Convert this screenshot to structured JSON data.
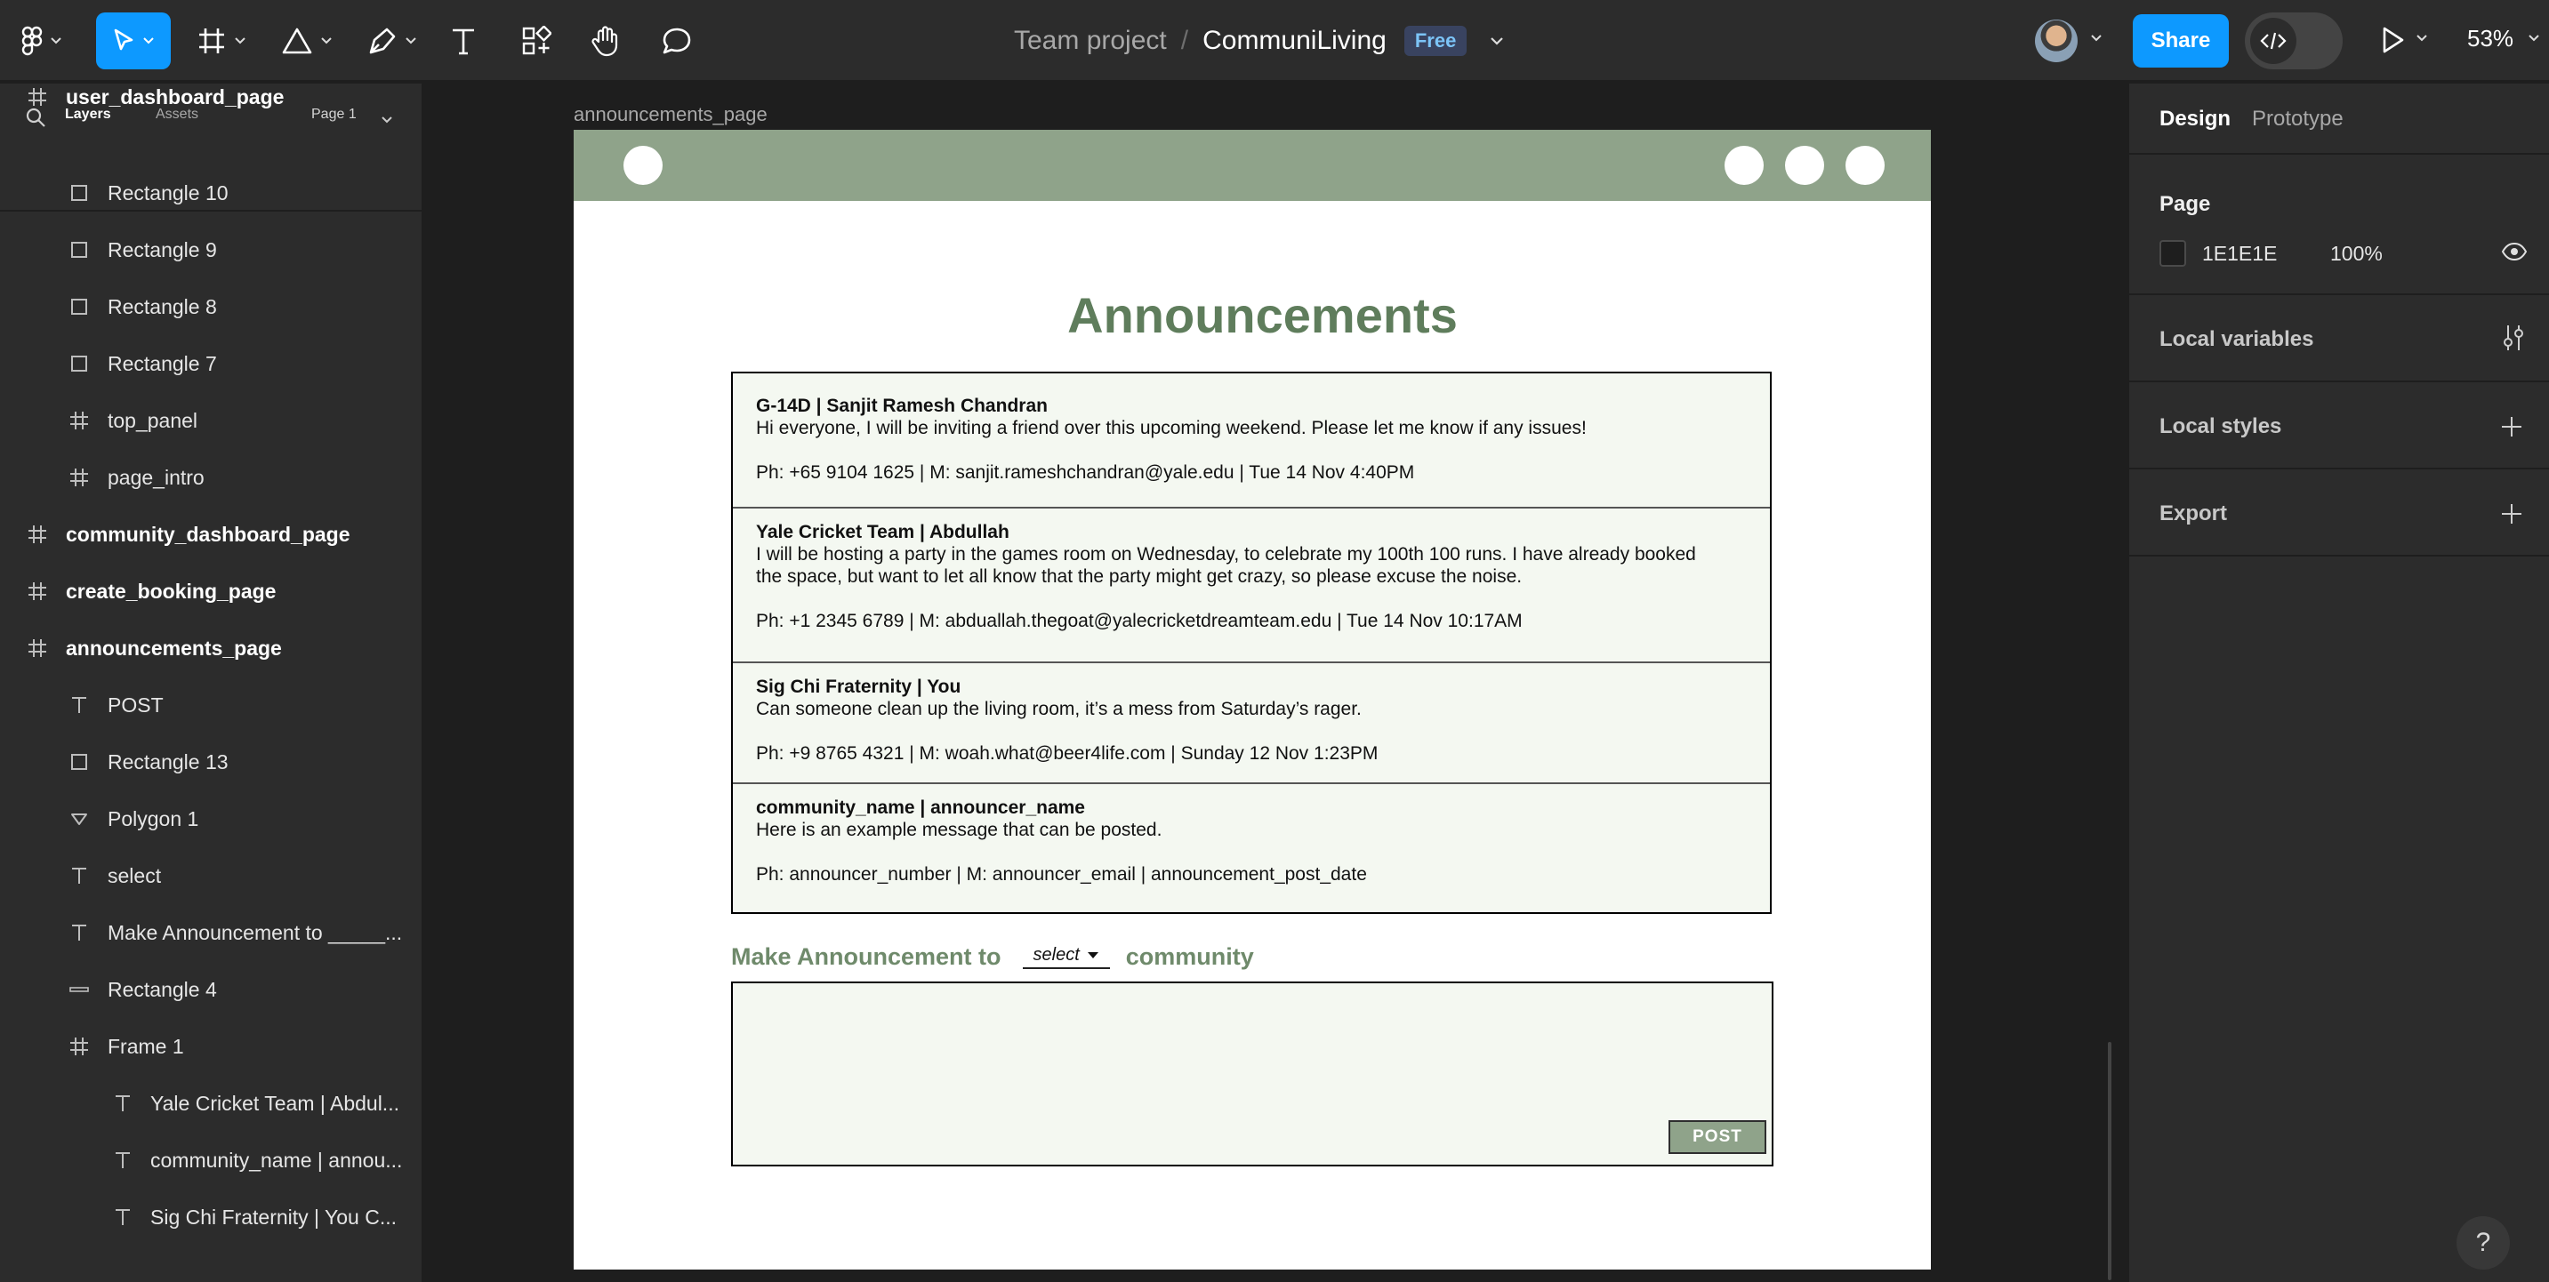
{
  "toolbar": {
    "breadcrumb_team": "Team project",
    "breadcrumb_sep": "/",
    "file_name": "CommuniLiving",
    "plan_badge": "Free",
    "share_label": "Share",
    "zoom_level": "53%",
    "icons": [
      "figma-menu-icon",
      "move-tool-icon",
      "frame-tool-icon",
      "shape-tool-icon",
      "pen-tool-icon",
      "text-tool-icon",
      "components-icon",
      "hand-tool-icon",
      "comment-icon",
      "dev-mode-icon",
      "present-icon"
    ]
  },
  "left_panel": {
    "tab_layers": "Layers",
    "tab_assets": "Assets",
    "page_selector": "Page 1",
    "layers": [
      {
        "label": "user_dashboard_page",
        "icon": "frame-icon",
        "top": true
      },
      {
        "label": "Rectangle 10",
        "icon": "rectangle-icon"
      },
      {
        "label": "Rectangle 9",
        "icon": "rectangle-icon"
      },
      {
        "label": "Rectangle 8",
        "icon": "rectangle-icon"
      },
      {
        "label": "Rectangle 7",
        "icon": "rectangle-icon"
      },
      {
        "label": "top_panel",
        "icon": "frame-icon"
      },
      {
        "label": "page_intro",
        "icon": "frame-icon"
      },
      {
        "label": "community_dashboard_page",
        "icon": "frame-icon",
        "top": true
      },
      {
        "label": "create_booking_page",
        "icon": "frame-icon",
        "top": true
      },
      {
        "label": "announcements_page",
        "icon": "frame-icon",
        "top": true
      },
      {
        "label": "POST",
        "icon": "text-icon"
      },
      {
        "label": "Rectangle 13",
        "icon": "rectangle-icon"
      },
      {
        "label": "Polygon 1",
        "icon": "polygon-icon"
      },
      {
        "label": "select",
        "icon": "text-icon"
      },
      {
        "label": "Make Announcement to _____...",
        "icon": "text-icon"
      },
      {
        "label": "Rectangle 4",
        "icon": "line-icon"
      },
      {
        "label": "Frame 1",
        "icon": "frame-icon"
      },
      {
        "label": "Yale Cricket Team | Abdul...",
        "icon": "text-icon"
      },
      {
        "label": "community_name | annou...",
        "icon": "text-icon"
      },
      {
        "label": "Sig Chi Fraternity | You C...",
        "icon": "text-icon"
      }
    ]
  },
  "canvas": {
    "frame_label": "announcements_page",
    "page_title": "Announcements",
    "announcements": [
      {
        "header": "G-14D | Sanjit Ramesh Chandran",
        "message": "Hi everyone, I will be inviting a friend over this upcoming weekend. Please let me know if any issues!",
        "contact": "Ph: +65 9104 1625 | M: sanjit.rameshchandran@yale.edu | Tue 14 Nov 4:40PM"
      },
      {
        "header": "Yale Cricket Team | Abdullah",
        "message": "I will be hosting a party in the games room on Wednesday, to celebrate my 100th 100 runs. I have already booked the space, but want to let all know that the party might get crazy, so please excuse the noise.",
        "contact": "Ph: +1 2345 6789 | M: abduallah.thegoat@yalecricketdreamteam.edu | Tue 14 Nov 10:17AM"
      },
      {
        "header": "Sig Chi Fraternity | You",
        "message": "Can someone clean up the living room, it’s a mess from Saturday’s rager.",
        "contact": "Ph: +9 8765 4321 | M: woah.what@beer4life.com | Sunday 12 Nov 1:23PM"
      },
      {
        "header": "community_name | announcer_name",
        "message": "Here is an example message that can be posted.",
        "contact": "Ph: announcer_number | M: announcer_email | announcement_post_date"
      }
    ],
    "make_prefix": "Make Announcement to",
    "select_value": "select",
    "make_suffix": "community",
    "post_label": "POST"
  },
  "right_panel": {
    "tab_design": "Design",
    "tab_prototype": "Prototype",
    "page_heading": "Page",
    "page_color_hex": "1E1E1E",
    "page_opacity": "100%",
    "local_variables": "Local variables",
    "local_styles": "Local styles",
    "export": "Export"
  },
  "colors": {
    "accent": "#0d99ff",
    "frame_bar": "#8fa38a",
    "title_green": "#5f7d5c",
    "card_bg": "#f4f8f1"
  },
  "help_label": "?"
}
